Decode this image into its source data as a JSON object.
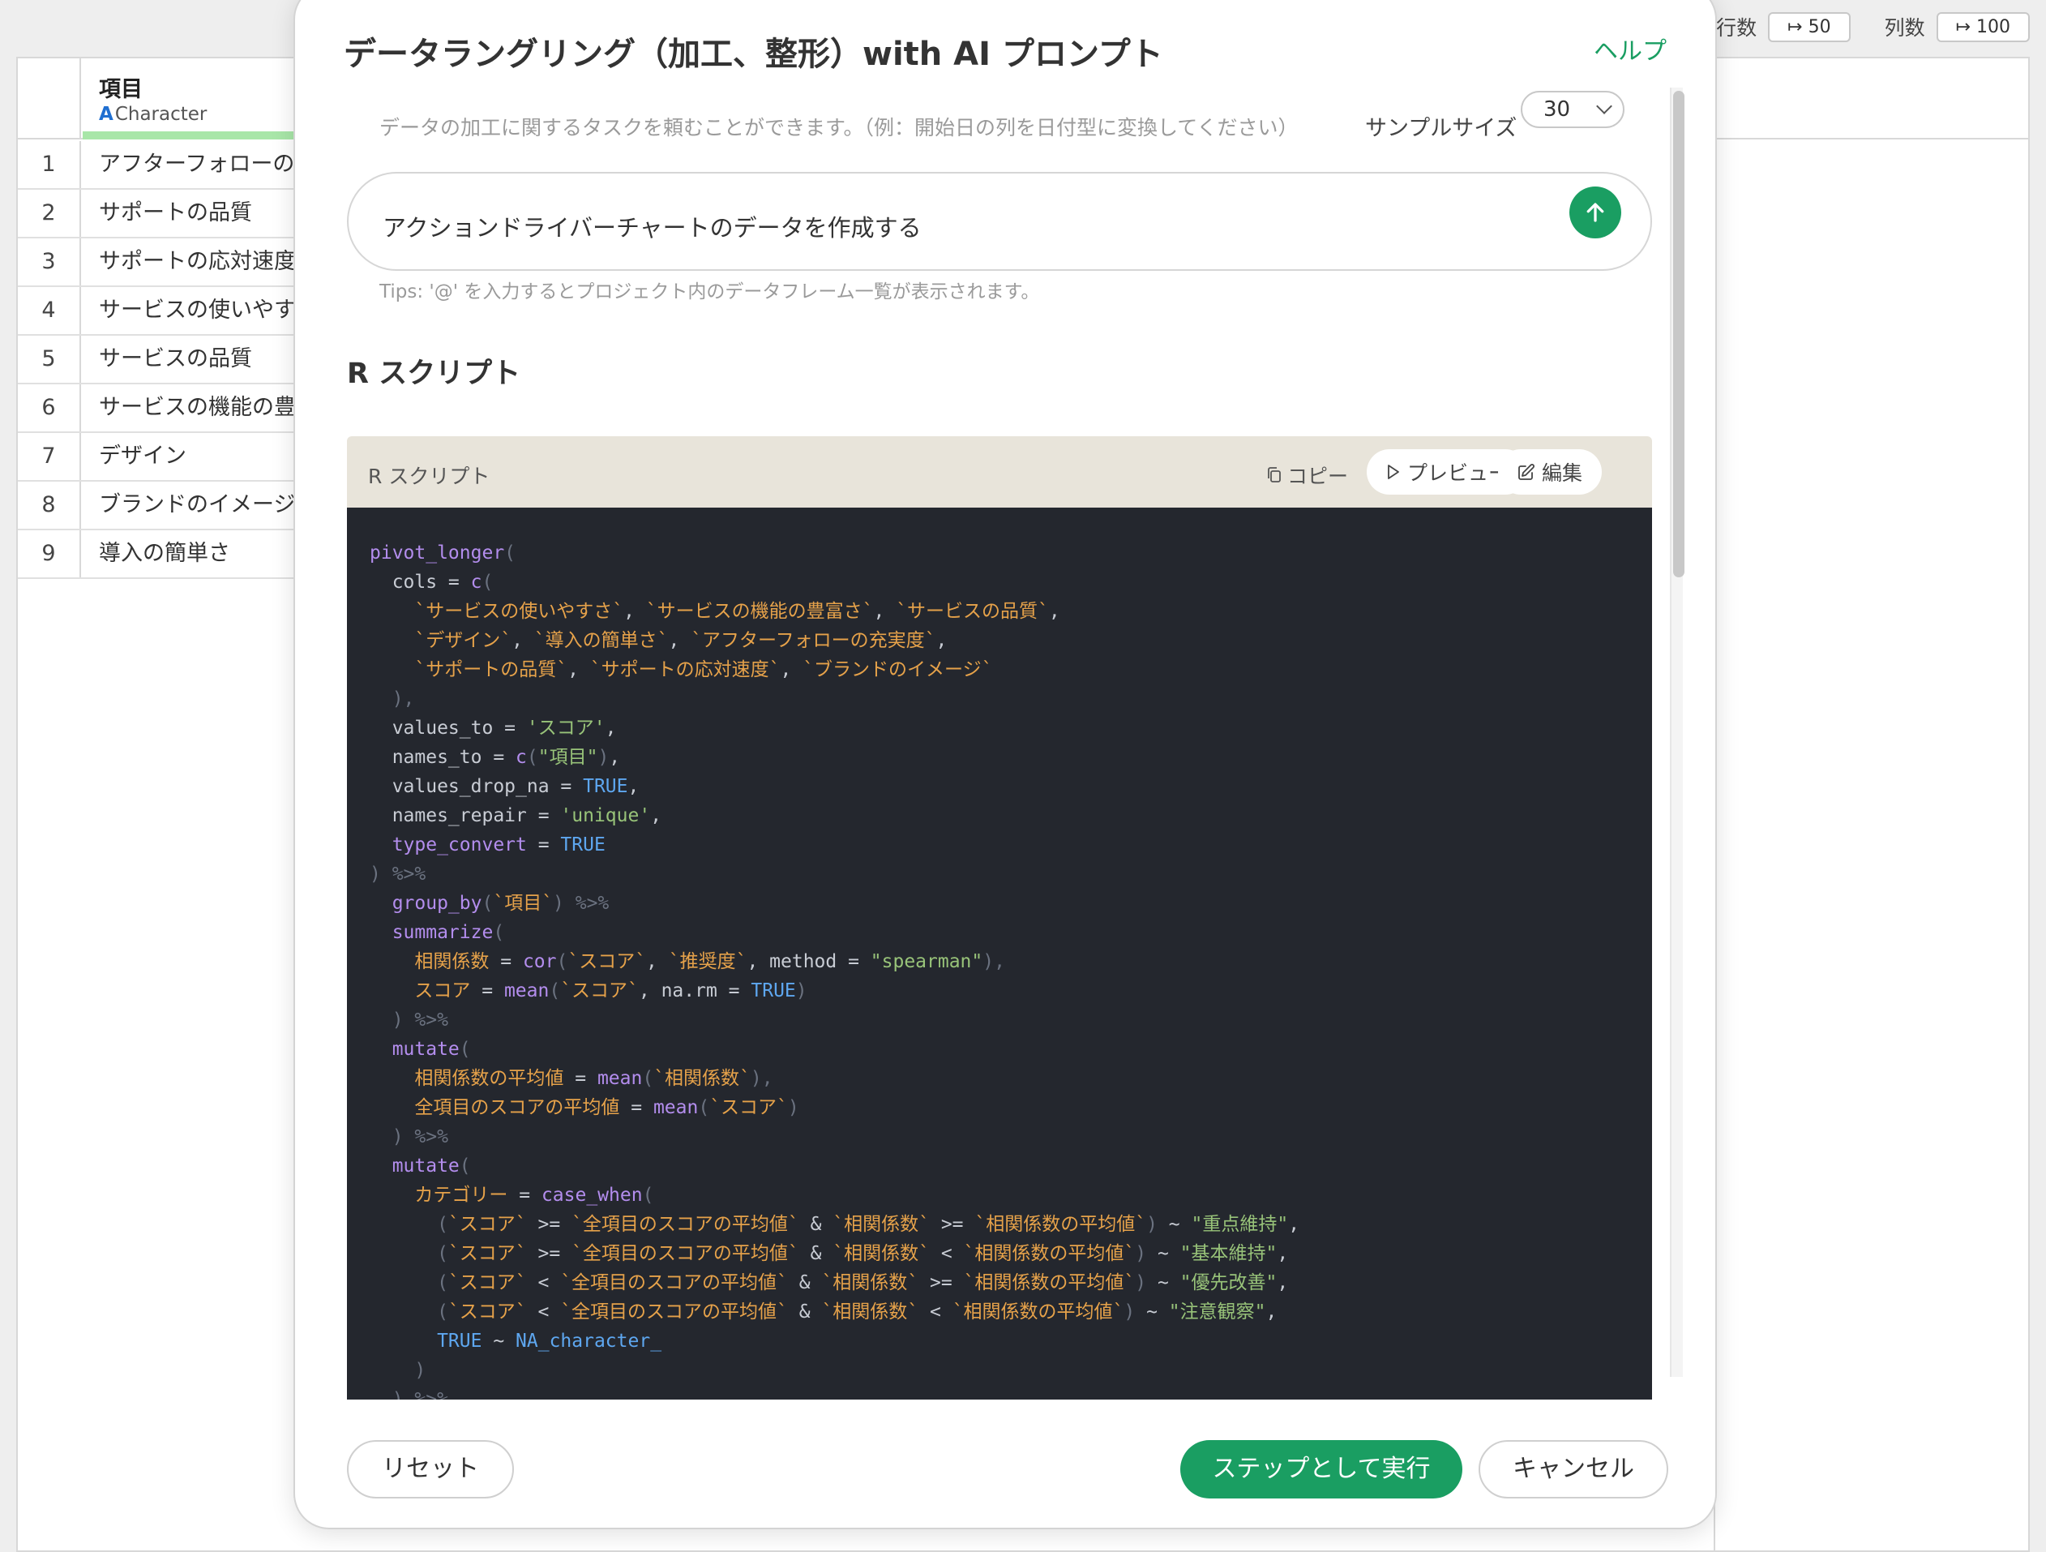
{
  "background": {
    "topbar": {
      "rows_label": "行数",
      "rows_value": "↦ 50",
      "cols_label": "列数",
      "cols_value": "↦ 100"
    },
    "column": {
      "name": "項目",
      "type_icon": "A",
      "type_label": "Character"
    },
    "rows": [
      {
        "num": "1",
        "text": "アフターフォローの"
      },
      {
        "num": "2",
        "text": "サポートの品質"
      },
      {
        "num": "3",
        "text": "サポートの応対速度"
      },
      {
        "num": "4",
        "text": "サービスの使いやす"
      },
      {
        "num": "5",
        "text": "サービスの品質"
      },
      {
        "num": "6",
        "text": "サービスの機能の豊"
      },
      {
        "num": "7",
        "text": "デザイン"
      },
      {
        "num": "8",
        "text": "ブランドのイメージ"
      },
      {
        "num": "9",
        "text": "導入の簡単さ"
      }
    ]
  },
  "modal": {
    "title": "データラングリング（加工、整形）with AI プロンプト",
    "help": "ヘルプ",
    "hint": "データの加工に関するタスクを頼むことができます。（例：開始日の列を日付型に変換してください）",
    "sample_label": "サンプルサイズ",
    "sample_value": "30",
    "prompt_value": "アクションドライバーチャートのデータを作成する",
    "tips": "Tips: '@' を入力するとプロジェクト内のデータフレーム一覧が表示されます。",
    "section_title": "R スクリプト",
    "code_header": "R スクリプト",
    "copy_label": "コピー",
    "preview_label": "プレビュー",
    "edit_label": "編集",
    "reset_label": "リセット",
    "run_label": "ステップとして実行",
    "cancel_label": "キャンセル"
  },
  "code_lines": [
    [
      [
        "f",
        "pivot_longer"
      ],
      [
        "p",
        "("
      ]
    ],
    [
      [
        "n",
        "  cols = "
      ],
      [
        "f",
        "c"
      ],
      [
        "p",
        "("
      ]
    ],
    [
      [
        "n",
        "    "
      ],
      [
        "s",
        "`サービスの使いやすさ`"
      ],
      [
        "n",
        ", "
      ],
      [
        "s",
        "`サービスの機能の豊富さ`"
      ],
      [
        "n",
        ", "
      ],
      [
        "s",
        "`サービスの品質`"
      ],
      [
        "n",
        ","
      ]
    ],
    [
      [
        "n",
        "    "
      ],
      [
        "s",
        "`デザイン`"
      ],
      [
        "n",
        ", "
      ],
      [
        "s",
        "`導入の簡単さ`"
      ],
      [
        "n",
        ", "
      ],
      [
        "s",
        "`アフターフォローの充実度`"
      ],
      [
        "n",
        ","
      ]
    ],
    [
      [
        "n",
        "    "
      ],
      [
        "s",
        "`サポートの品質`"
      ],
      [
        "n",
        ", "
      ],
      [
        "s",
        "`サポートの応対速度`"
      ],
      [
        "n",
        ", "
      ],
      [
        "s",
        "`ブランドのイメージ`"
      ]
    ],
    [
      [
        "p",
        "  ),"
      ]
    ],
    [
      [
        "n",
        "  values_to = "
      ],
      [
        "g",
        "'スコア'"
      ],
      [
        "n",
        ","
      ]
    ],
    [
      [
        "n",
        "  names_to = "
      ],
      [
        "f",
        "c"
      ],
      [
        "p",
        "("
      ],
      [
        "g",
        "\"項目\""
      ],
      [
        "p",
        ")"
      ],
      [
        "n",
        ","
      ]
    ],
    [
      [
        "n",
        "  values_drop_na = "
      ],
      [
        "b",
        "TRUE"
      ],
      [
        "n",
        ","
      ]
    ],
    [
      [
        "n",
        "  names_repair = "
      ],
      [
        "g",
        "'unique'"
      ],
      [
        "n",
        ","
      ]
    ],
    [
      [
        "f",
        "  type_convert"
      ],
      [
        "n",
        " = "
      ],
      [
        "b",
        "TRUE"
      ]
    ],
    [
      [
        "p",
        ") %>%"
      ]
    ],
    [
      [
        "f",
        "  group_by"
      ],
      [
        "p",
        "("
      ],
      [
        "s",
        "`項目`"
      ],
      [
        "p",
        ") %>%"
      ]
    ],
    [
      [
        "f",
        "  summarize"
      ],
      [
        "p",
        "("
      ]
    ],
    [
      [
        "s",
        "    相関係数"
      ],
      [
        "n",
        " = "
      ],
      [
        "f",
        "cor"
      ],
      [
        "p",
        "("
      ],
      [
        "s",
        "`スコア`"
      ],
      [
        "n",
        ", "
      ],
      [
        "s",
        "`推奨度`"
      ],
      [
        "n",
        ", method = "
      ],
      [
        "g",
        "\"spearman\""
      ],
      [
        "p",
        "),"
      ]
    ],
    [
      [
        "s",
        "    スコア"
      ],
      [
        "n",
        " = "
      ],
      [
        "f",
        "mean"
      ],
      [
        "p",
        "("
      ],
      [
        "s",
        "`スコア`"
      ],
      [
        "n",
        ", na.rm = "
      ],
      [
        "b",
        "TRUE"
      ],
      [
        "p",
        ")"
      ]
    ],
    [
      [
        "p",
        "  ) %>%"
      ]
    ],
    [
      [
        "f",
        "  mutate"
      ],
      [
        "p",
        "("
      ]
    ],
    [
      [
        "s",
        "    相関係数の平均値"
      ],
      [
        "n",
        " = "
      ],
      [
        "f",
        "mean"
      ],
      [
        "p",
        "("
      ],
      [
        "s",
        "`相関係数`"
      ],
      [
        "p",
        "),"
      ]
    ],
    [
      [
        "s",
        "    全項目のスコアの平均値"
      ],
      [
        "n",
        " = "
      ],
      [
        "f",
        "mean"
      ],
      [
        "p",
        "("
      ],
      [
        "s",
        "`スコア`"
      ],
      [
        "p",
        ")"
      ]
    ],
    [
      [
        "p",
        "  ) %>%"
      ]
    ],
    [
      [
        "f",
        "  mutate"
      ],
      [
        "p",
        "("
      ]
    ],
    [
      [
        "s",
        "    カテゴリー"
      ],
      [
        "n",
        " = "
      ],
      [
        "f",
        "case_when"
      ],
      [
        "p",
        "("
      ]
    ],
    [
      [
        "p",
        "      ("
      ],
      [
        "s",
        "`スコア`"
      ],
      [
        "n",
        " >= "
      ],
      [
        "s",
        "`全項目のスコアの平均値`"
      ],
      [
        "n",
        " & "
      ],
      [
        "s",
        "`相関係数`"
      ],
      [
        "n",
        " >= "
      ],
      [
        "s",
        "`相関係数の平均値`"
      ],
      [
        "p",
        ")"
      ],
      [
        "n",
        " ~ "
      ],
      [
        "g",
        "\"重点維持\""
      ],
      [
        "n",
        ","
      ]
    ],
    [
      [
        "p",
        "      ("
      ],
      [
        "s",
        "`スコア`"
      ],
      [
        "n",
        " >= "
      ],
      [
        "s",
        "`全項目のスコアの平均値`"
      ],
      [
        "n",
        " & "
      ],
      [
        "s",
        "`相関係数`"
      ],
      [
        "n",
        " < "
      ],
      [
        "s",
        "`相関係数の平均値`"
      ],
      [
        "p",
        ")"
      ],
      [
        "n",
        " ~ "
      ],
      [
        "g",
        "\"基本維持\""
      ],
      [
        "n",
        ","
      ]
    ],
    [
      [
        "p",
        "      ("
      ],
      [
        "s",
        "`スコア`"
      ],
      [
        "n",
        " < "
      ],
      [
        "s",
        "`全項目のスコアの平均値`"
      ],
      [
        "n",
        " & "
      ],
      [
        "s",
        "`相関係数`"
      ],
      [
        "n",
        " >= "
      ],
      [
        "s",
        "`相関係数の平均値`"
      ],
      [
        "p",
        ")"
      ],
      [
        "n",
        " ~ "
      ],
      [
        "g",
        "\"優先改善\""
      ],
      [
        "n",
        ","
      ]
    ],
    [
      [
        "p",
        "      ("
      ],
      [
        "s",
        "`スコア`"
      ],
      [
        "n",
        " < "
      ],
      [
        "s",
        "`全項目のスコアの平均値`"
      ],
      [
        "n",
        " & "
      ],
      [
        "s",
        "`相関係数`"
      ],
      [
        "n",
        " < "
      ],
      [
        "s",
        "`相関係数の平均値`"
      ],
      [
        "p",
        ")"
      ],
      [
        "n",
        " ~ "
      ],
      [
        "g",
        "\"注意観察\""
      ],
      [
        "n",
        ","
      ]
    ],
    [
      [
        "b",
        "      TRUE"
      ],
      [
        "n",
        " ~ "
      ],
      [
        "b",
        "NA_character_"
      ]
    ],
    [
      [
        "p",
        "    )"
      ]
    ],
    [
      [
        "p",
        "  ) %>%"
      ]
    ]
  ],
  "colors": {
    "accent": "#1a9e62",
    "code_bg": "#24272e",
    "code_header_bg": "#e8e4da"
  }
}
